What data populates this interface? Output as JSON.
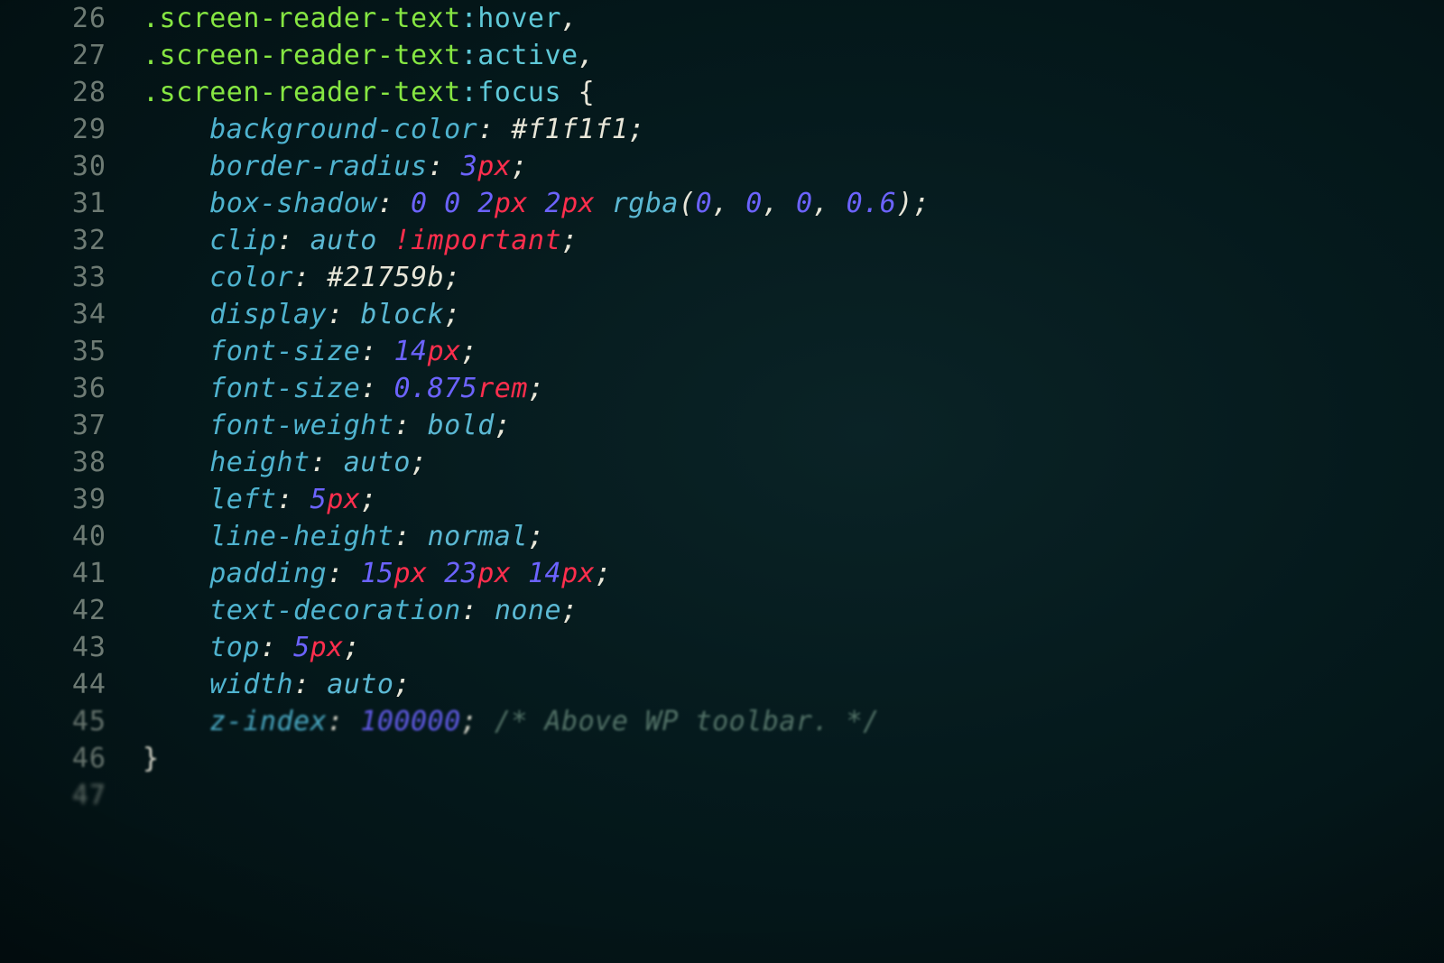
{
  "colors": {
    "background": "#041618",
    "gutter": "#6e7b74",
    "selector": "#86e642",
    "pseudo": "#5fc9d8",
    "property": "#4fb3cf",
    "punctuation": "#e8e6d8",
    "number": "#6c63ff",
    "unit_important": "#ff2e4d",
    "keyword": "#5bb8d3",
    "comment": "#5a7a6e"
  },
  "indent_unit": "    ",
  "lines": [
    {
      "n": "26",
      "indent": 0,
      "tokens": [
        {
          "t": "sel",
          "v": ".screen-reader-text"
        },
        {
          "t": "pse",
          "v": ":hover"
        },
        {
          "t": "comma",
          "v": ","
        }
      ]
    },
    {
      "n": "27",
      "indent": 0,
      "tokens": [
        {
          "t": "sel",
          "v": ".screen-reader-text"
        },
        {
          "t": "pse",
          "v": ":active"
        },
        {
          "t": "comma",
          "v": ","
        }
      ]
    },
    {
      "n": "28",
      "indent": 0,
      "tokens": [
        {
          "t": "sel",
          "v": ".screen-reader-text"
        },
        {
          "t": "pse",
          "v": ":focus"
        },
        {
          "t": "sp",
          "v": " "
        },
        {
          "t": "brace",
          "v": "{"
        }
      ]
    },
    {
      "n": "29",
      "indent": 1,
      "tokens": [
        {
          "t": "prop",
          "v": "background-color"
        },
        {
          "t": "colon",
          "v": ":"
        },
        {
          "t": "sp",
          "v": " "
        },
        {
          "t": "hexv",
          "v": "#f1f1f1"
        },
        {
          "t": "semi",
          "v": ";"
        }
      ]
    },
    {
      "n": "30",
      "indent": 1,
      "tokens": [
        {
          "t": "prop",
          "v": "border-radius"
        },
        {
          "t": "colon",
          "v": ":"
        },
        {
          "t": "sp",
          "v": " "
        },
        {
          "t": "num",
          "v": "3"
        },
        {
          "t": "unit",
          "v": "px"
        },
        {
          "t": "semi",
          "v": ";"
        }
      ]
    },
    {
      "n": "31",
      "indent": 1,
      "tokens": [
        {
          "t": "prop",
          "v": "box-shadow"
        },
        {
          "t": "colon",
          "v": ":"
        },
        {
          "t": "sp",
          "v": " "
        },
        {
          "t": "num",
          "v": "0"
        },
        {
          "t": "sp",
          "v": " "
        },
        {
          "t": "num",
          "v": "0"
        },
        {
          "t": "sp",
          "v": " "
        },
        {
          "t": "num",
          "v": "2"
        },
        {
          "t": "unit",
          "v": "px"
        },
        {
          "t": "sp",
          "v": " "
        },
        {
          "t": "num",
          "v": "2"
        },
        {
          "t": "unit",
          "v": "px"
        },
        {
          "t": "sp",
          "v": " "
        },
        {
          "t": "func",
          "v": "rgba"
        },
        {
          "t": "paren",
          "v": "("
        },
        {
          "t": "num",
          "v": "0"
        },
        {
          "t": "comma",
          "v": ","
        },
        {
          "t": "sp",
          "v": " "
        },
        {
          "t": "num",
          "v": "0"
        },
        {
          "t": "comma",
          "v": ","
        },
        {
          "t": "sp",
          "v": " "
        },
        {
          "t": "num",
          "v": "0"
        },
        {
          "t": "comma",
          "v": ","
        },
        {
          "t": "sp",
          "v": " "
        },
        {
          "t": "num",
          "v": "0.6"
        },
        {
          "t": "paren",
          "v": ")"
        },
        {
          "t": "semi",
          "v": ";"
        }
      ]
    },
    {
      "n": "32",
      "indent": 1,
      "tokens": [
        {
          "t": "prop",
          "v": "clip"
        },
        {
          "t": "colon",
          "v": ":"
        },
        {
          "t": "sp",
          "v": " "
        },
        {
          "t": "kw",
          "v": "auto"
        },
        {
          "t": "sp",
          "v": " "
        },
        {
          "t": "imp",
          "v": "!important"
        },
        {
          "t": "semi",
          "v": ";"
        }
      ]
    },
    {
      "n": "33",
      "indent": 1,
      "tokens": [
        {
          "t": "prop",
          "v": "color"
        },
        {
          "t": "colon",
          "v": ":"
        },
        {
          "t": "sp",
          "v": " "
        },
        {
          "t": "hexv",
          "v": "#21759b"
        },
        {
          "t": "semi",
          "v": ";"
        }
      ]
    },
    {
      "n": "34",
      "indent": 1,
      "tokens": [
        {
          "t": "prop",
          "v": "display"
        },
        {
          "t": "colon",
          "v": ":"
        },
        {
          "t": "sp",
          "v": " "
        },
        {
          "t": "kw",
          "v": "block"
        },
        {
          "t": "semi",
          "v": ";"
        }
      ]
    },
    {
      "n": "35",
      "indent": 1,
      "tokens": [
        {
          "t": "prop",
          "v": "font-size"
        },
        {
          "t": "colon",
          "v": ":"
        },
        {
          "t": "sp",
          "v": " "
        },
        {
          "t": "num",
          "v": "14"
        },
        {
          "t": "unit",
          "v": "px"
        },
        {
          "t": "semi",
          "v": ";"
        }
      ]
    },
    {
      "n": "36",
      "indent": 1,
      "tokens": [
        {
          "t": "prop",
          "v": "font-size"
        },
        {
          "t": "colon",
          "v": ":"
        },
        {
          "t": "sp",
          "v": " "
        },
        {
          "t": "num",
          "v": "0.875"
        },
        {
          "t": "unit",
          "v": "rem"
        },
        {
          "t": "semi",
          "v": ";"
        }
      ]
    },
    {
      "n": "37",
      "indent": 1,
      "tokens": [
        {
          "t": "prop",
          "v": "font-weight"
        },
        {
          "t": "colon",
          "v": ":"
        },
        {
          "t": "sp",
          "v": " "
        },
        {
          "t": "kw",
          "v": "bold"
        },
        {
          "t": "semi",
          "v": ";"
        }
      ]
    },
    {
      "n": "38",
      "indent": 1,
      "tokens": [
        {
          "t": "prop",
          "v": "height"
        },
        {
          "t": "colon",
          "v": ":"
        },
        {
          "t": "sp",
          "v": " "
        },
        {
          "t": "kw",
          "v": "auto"
        },
        {
          "t": "semi",
          "v": ";"
        }
      ]
    },
    {
      "n": "39",
      "indent": 1,
      "tokens": [
        {
          "t": "prop",
          "v": "left"
        },
        {
          "t": "colon",
          "v": ":"
        },
        {
          "t": "sp",
          "v": " "
        },
        {
          "t": "num",
          "v": "5"
        },
        {
          "t": "unit",
          "v": "px"
        },
        {
          "t": "semi",
          "v": ";"
        }
      ]
    },
    {
      "n": "40",
      "indent": 1,
      "tokens": [
        {
          "t": "prop",
          "v": "line-height"
        },
        {
          "t": "colon",
          "v": ":"
        },
        {
          "t": "sp",
          "v": " "
        },
        {
          "t": "kw",
          "v": "normal"
        },
        {
          "t": "semi",
          "v": ";"
        }
      ]
    },
    {
      "n": "41",
      "indent": 1,
      "tokens": [
        {
          "t": "prop",
          "v": "padding"
        },
        {
          "t": "colon",
          "v": ":"
        },
        {
          "t": "sp",
          "v": " "
        },
        {
          "t": "num",
          "v": "15"
        },
        {
          "t": "unit",
          "v": "px"
        },
        {
          "t": "sp",
          "v": " "
        },
        {
          "t": "num",
          "v": "23"
        },
        {
          "t": "unit",
          "v": "px"
        },
        {
          "t": "sp",
          "v": " "
        },
        {
          "t": "num",
          "v": "14"
        },
        {
          "t": "unit",
          "v": "px"
        },
        {
          "t": "semi",
          "v": ";"
        }
      ]
    },
    {
      "n": "42",
      "indent": 1,
      "tokens": [
        {
          "t": "prop",
          "v": "text-decoration"
        },
        {
          "t": "colon",
          "v": ":"
        },
        {
          "t": "sp",
          "v": " "
        },
        {
          "t": "kw",
          "v": "none"
        },
        {
          "t": "semi",
          "v": ";"
        }
      ]
    },
    {
      "n": "43",
      "indent": 1,
      "tokens": [
        {
          "t": "prop",
          "v": "top"
        },
        {
          "t": "colon",
          "v": ":"
        },
        {
          "t": "sp",
          "v": " "
        },
        {
          "t": "num",
          "v": "5"
        },
        {
          "t": "unit",
          "v": "px"
        },
        {
          "t": "semi",
          "v": ";"
        }
      ]
    },
    {
      "n": "44",
      "indent": 1,
      "tokens": [
        {
          "t": "prop",
          "v": "width"
        },
        {
          "t": "colon",
          "v": ":"
        },
        {
          "t": "sp",
          "v": " "
        },
        {
          "t": "kw",
          "v": "auto"
        },
        {
          "t": "semi",
          "v": ";"
        }
      ]
    },
    {
      "n": "45",
      "indent": 1,
      "blur": "blurlow",
      "tokens": [
        {
          "t": "prop",
          "v": "z-index"
        },
        {
          "t": "colon",
          "v": ":"
        },
        {
          "t": "sp",
          "v": " "
        },
        {
          "t": "num",
          "v": "100000"
        },
        {
          "t": "semi",
          "v": ";"
        },
        {
          "t": "sp",
          "v": " "
        },
        {
          "t": "cmt",
          "v": "/* Above WP toolbar. */"
        }
      ]
    },
    {
      "n": "46",
      "indent": 0,
      "blur": "blurlow",
      "tokens": [
        {
          "t": "brace",
          "v": "}"
        }
      ]
    },
    {
      "n": "47",
      "indent": 0,
      "blur": "blurmore",
      "tokens": []
    }
  ]
}
